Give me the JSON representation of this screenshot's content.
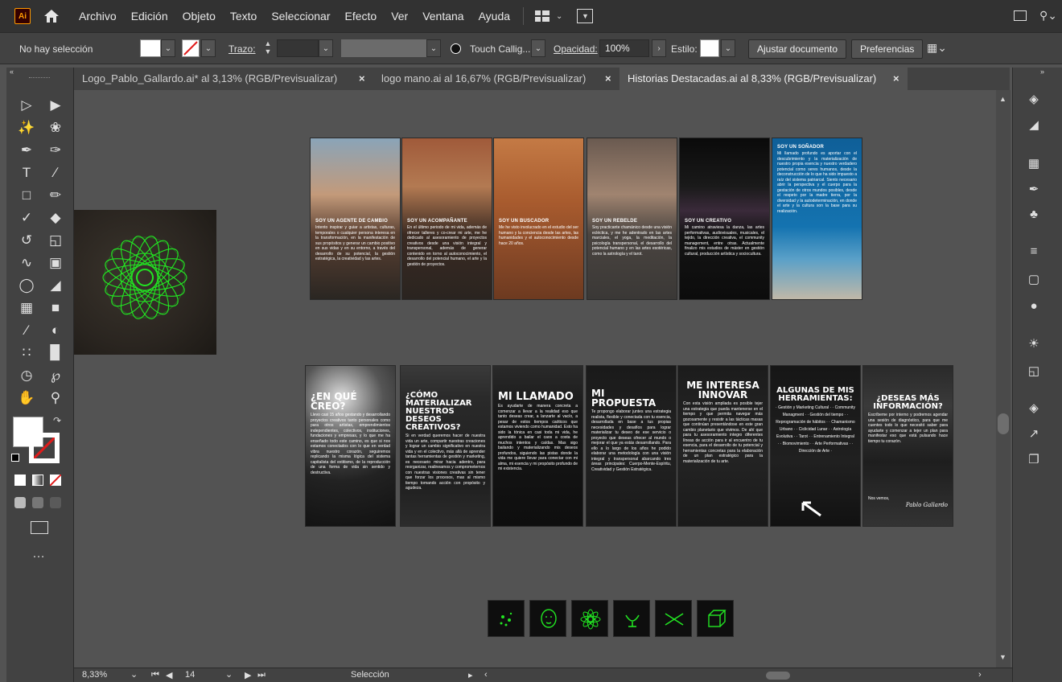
{
  "app": {
    "logo": "Ai"
  },
  "menu": [
    "Archivo",
    "Edición",
    "Objeto",
    "Texto",
    "Seleccionar",
    "Efecto",
    "Ver",
    "Ventana",
    "Ayuda"
  ],
  "control": {
    "selection": "No hay selección",
    "stroke_label": "Trazo:",
    "brush_name": "Touch Callig...",
    "opacity_label": "Opacidad:",
    "opacity_value": "100%",
    "style_label": "Estilo:",
    "adjust_button": "Ajustar documento",
    "prefs_button": "Preferencias"
  },
  "tabs": [
    {
      "label": "Logo_Pablo_Gallardo.ai* al 3,13% (RGB/Previsualizar)",
      "active": false
    },
    {
      "label": "logo mano.ai al 16,67% (RGB/Previsualizar)",
      "active": false
    },
    {
      "label": "Historias Destacadas.ai al 8,33% (RGB/Previsualizar)",
      "active": true
    }
  ],
  "status": {
    "zoom": "8,33%",
    "artboard": "14",
    "tool": "Selección"
  },
  "artboards": {
    "top": [
      {
        "title": "SOY UN AGENTE DE CAMBIO",
        "body": "Intento inspirar y guiar a artistas, culturas, temporales o cualquier persona interesa en la transformación, en la manifestación de sus propósitos y generar un cambio positivo en sus vidas y en su entorno, a través del desarrollo de su potencial, la gestión estratégica, la creatividad y las artes."
      },
      {
        "title": "SOY UN ACOMPAÑANTE",
        "body": "En el último periodo de mi vida, además de ofrecer talleres y co-crear mi arte, me he dedicado al asesoramiento de proyectos creativos desde una visión integral y transpersonal, además de generar contenido en torno al autoconocimiento, el desarrollo del potencial humano, el arte y la gestión de proyectos."
      },
      {
        "title": "SOY UN BUSCADOR",
        "body": "Me he visto involucrado en el estudio del ser humano y la conciencia desde las artes, las humanidades y el autoconocimiento desde hace 20 años."
      },
      {
        "title": "SOY UN REBELDE",
        "body": "Soy practicante chamánico desde una visión ecléctica, y me he adentrado en las artes marciales, el yoga, la meditación, la psicología transpersonal, el desarrollo del potencial humano y en las artes esotéricas, como la astrología y el tarot."
      },
      {
        "title": "SOY UN CREATIVO",
        "body": "Mi camino atraviesa la danza, las artes performativas, audiovisuales, musicales, el tejido, la dirección creativa, el community management, entre otras. Actualmente finalizo mis estudios de máster en gestión cultural, producción artística y sociocultura."
      },
      {
        "title": "SOY UN SOÑADOR",
        "body": "Mi llamado profundo es aportar con el descubrimiento y la materialización de nuestro propia esencia y nuestro verdadero potencial como seres humanos, desde la deconstrucción de lo que ha sido impuesto a raíz del sistema patriarcal. Siento necesario abrir la perspectiva y el cuerpo para la gestación de otros mundos posibles, desde el respeto por la madre tierra, por la diversidad y la autodeterminación, en donde el arte y la cultura son la base para su realización."
      }
    ],
    "bottom": [
      {
        "title": "¿EN QUÉ CREO?",
        "body": "Llevo casi 15 años gestando y desarrollando proyectos creativos tanto personales como para otros artistas, emprendimientos independientes, colectivos, instituciones, fundaciones y empresas, y lo que me ha enseñado todo este camino, es que si nos estamos conectados con lo que en verdad vibra nuestro corazón, seguiremos replicando la misma lógica del sistema capitalista del extitismo, de la reproducción de una forma de vida sin sentido y destructiva."
      },
      {
        "title": "¿CÓMO MATERIALIZAR NUESTROS DESEOS CREATIVOS?",
        "body": "Si en verdad queremos hacer de nuestra vida un arte, compartir nuestras creaciones y lograr un cambio significativo en nuestra vida y en el colectivo, más allá de aprender tantas herramientas de gestión y marketing, es necesario mirar hacia adentro, para reorganizar, realinearnos y comprometernos con nuestras visiones creativas sin tener que forzar los procesos, mas al mismo tiempo tomando acción con propósito y agudeza."
      },
      {
        "title": "MI LLAMADO",
        "body": "Es ayudarte de manera concreta a comenzar a llevar a la realidad eso que tanto deseas crear, a lanzarte al vacío, a pesar de estos tiempos caóticos que estamos viviendo como humanidad. Esto ha sido la tónica en casi toda mi vida, he aprendido a bailar el caos a costa de muchos intentos y caídas. Mas sigo bailando y materializando mis deseos profundos, siguiendo las pistas donde la vida me quiere llevar para conectar con mi alma, mi esencia y mi propósito profundo de mi existencia."
      },
      {
        "title": "MI PROPUESTA",
        "body": "Te propongo elaborar juntes una estrategia realista, flexible y conectada con tu esencia, desarrollada en base a tus propias necesidades y desafíos para lograr materializar tu deseo de ese servicio o proyecto que deseas ofrecer al mundo o mejorar el que ya estás desarrollando. Para ello a lo largo de los años he podido elaborar una metodología con una visión integral y transpersonal abarcando tres áreas principales: Cuerpo-Mente-Espíritu, Creatividad y Gestión Estratégica."
      },
      {
        "title": "ME INTERESA INNOVAR",
        "body": "Con esta visión ampliada es posible tejer una estrategia que pueda mantenerse en el tiempo y que permita navegar más gozosamente y resistir a las tácticas masas que continúan presentándose en este gran cambio planetario que vivimos. De ahí que para tu asesoramiento integro diferentes líneas de acción para ir al encuentro de tu esencia, para el desarrollo de tu potencial y herramientas concretas para la elaboración de un plan estratégico para la materialización de tu arte."
      },
      {
        "title": "ALGUNAS DE MIS HERRAMIENTAS:",
        "body": "· Gestión y Marketing Cultural · · Community Managment · · Gestión del tiempo · · Reprogramación de hábitos · · Chamanismo Urbano · · Ciclicidad Lunar · · Astrología Evolutiva · · Tarot · · Entrenamiento Integral · · Biomovimiento · · Arte Performativas · · Dirección de Arte ·"
      },
      {
        "title": "¿DESEAS MÁS INFORMACIÓN?",
        "body": "Escríbeme por interno y podremos agendar una sesión de diagnóstico, para que me cuentes todo lo que necesitó saber para ayudarte y comenzar a tejer un plan para manifestar eso que está pulsando hace tiempo tu corazón.",
        "footer": "Nos vemos,",
        "signature": "Pablo Gallardo"
      }
    ]
  },
  "colors": {
    "accent_green": "#22e622",
    "canvas": "#535353",
    "panel": "#424242",
    "menubar": "#323232"
  },
  "icons": {
    "tiles": [
      "sparkle-icon",
      "face-icon",
      "mandala-icon",
      "hand-icon",
      "fish-icon",
      "cube-icon"
    ]
  }
}
